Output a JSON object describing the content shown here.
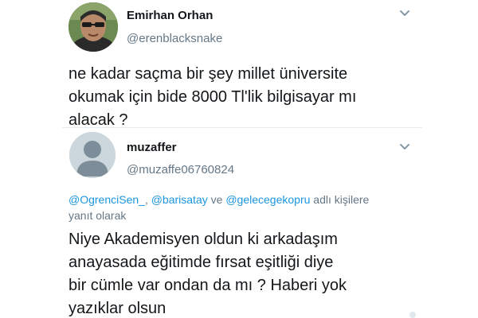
{
  "tweet1": {
    "author_name": "Emirhan Orhan",
    "handle": "@erenblacksnake",
    "text_lines": [
      "ne kadar saçma bir şey millet üniversite",
      "okumak için bide 8000 Tl'lik bilgisayar mı",
      "alacak ?"
    ],
    "menu_icon": "chevron-down-icon"
  },
  "tweet2": {
    "author_name": "muzaffer",
    "handle": "@muzaffe06760824",
    "reply_mentions": [
      "@OgrenciSen_",
      "@barisatay",
      "@gelecegekopru"
    ],
    "reply_sep": ", ",
    "reply_and": " ve ",
    "reply_suffix_line1": " adlı kişilere",
    "reply_suffix_line2": "yanıt olarak",
    "text_lines": [
      "Niye Akademisyen oldun ki arkadaşım",
      "anayasada eğitimde fırsat eşitliği diye",
      "bir cümle var ondan da mı ? Haberi yok",
      "yazıklar olsun"
    ],
    "menu_icon": "chevron-down-icon",
    "avatar_icon": "default-avatar-icon"
  },
  "colors": {
    "text": "#14171a",
    "secondary": "#657786",
    "link": "#1b95e0",
    "divider": "#e6ecf0"
  }
}
